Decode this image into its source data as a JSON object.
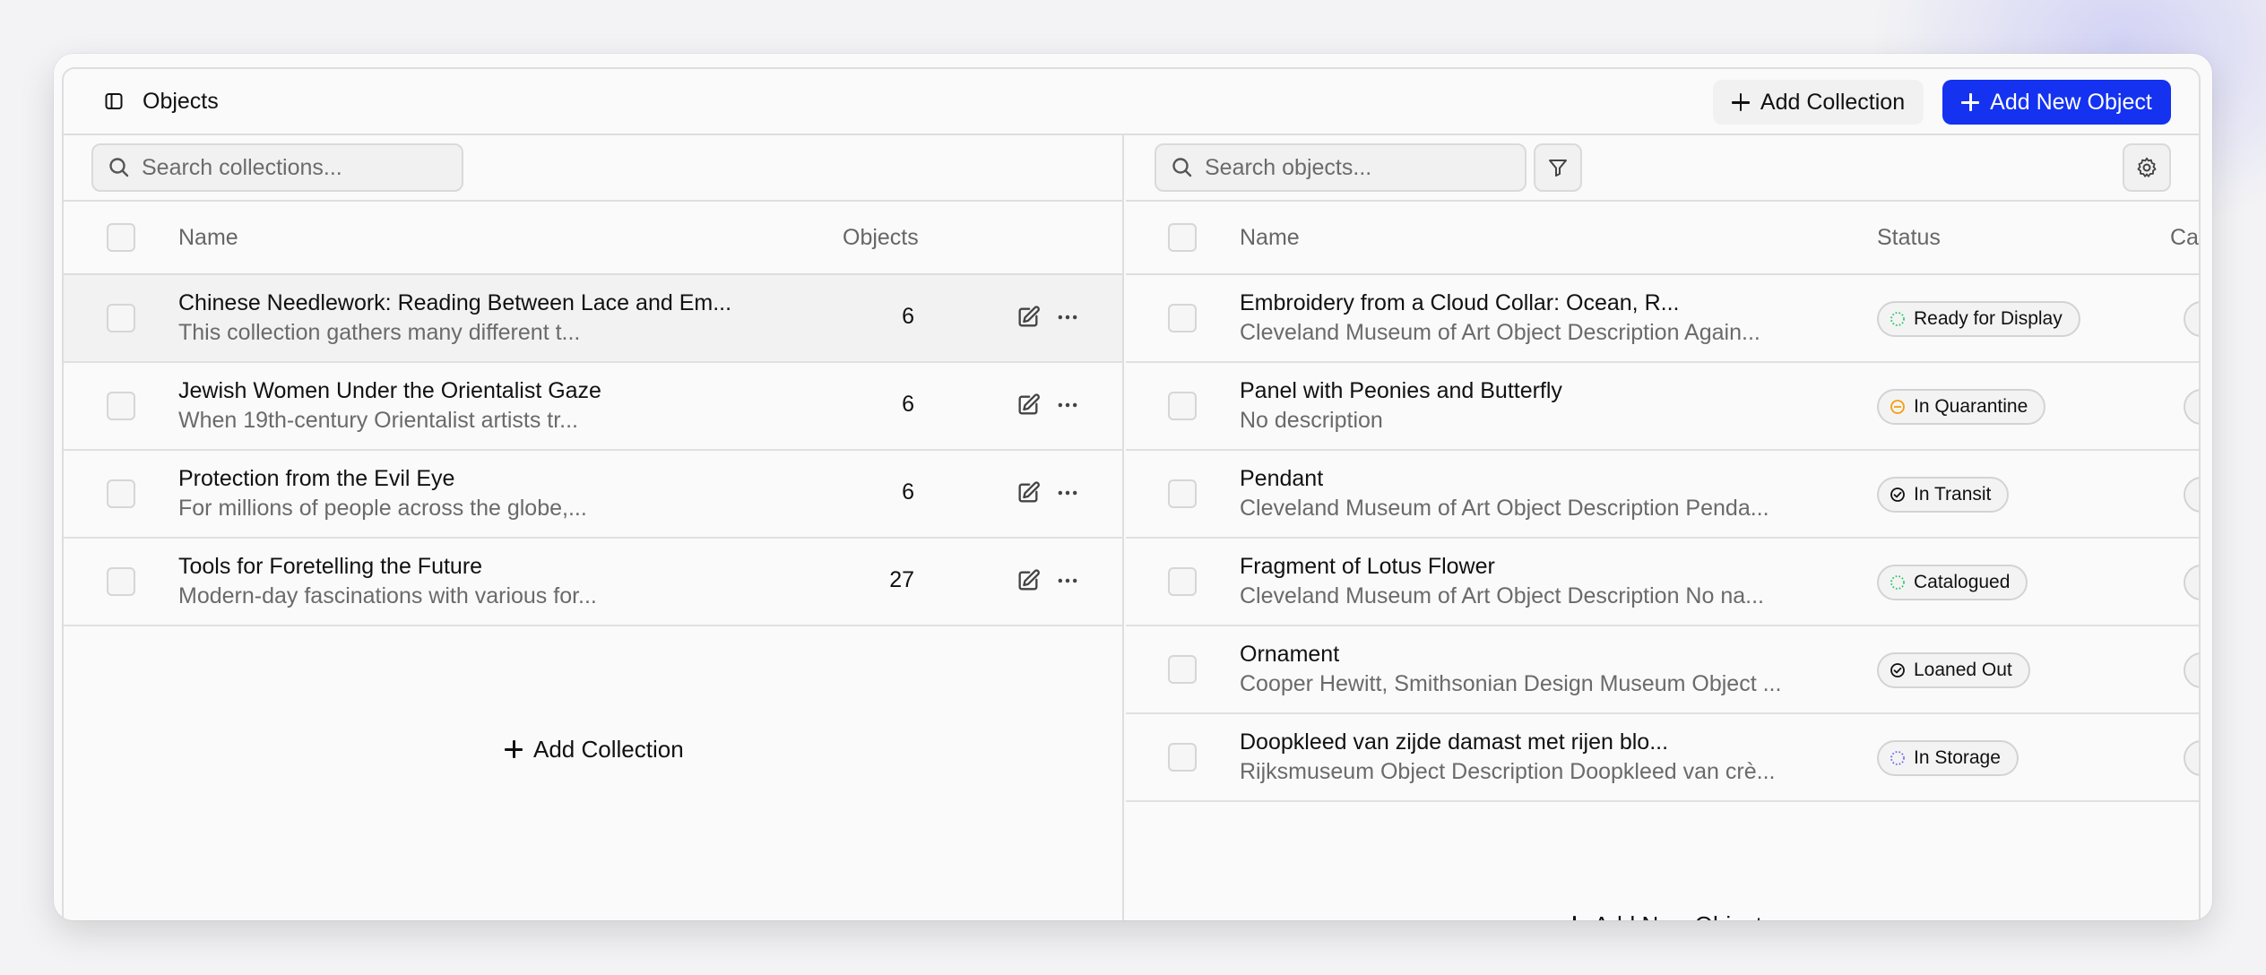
{
  "header": {
    "title": "Objects",
    "add_collection_label": "Add Collection",
    "add_object_label": "Add New Object",
    "accent_color": "#1432f0"
  },
  "collections": {
    "search_placeholder": "Search collections...",
    "columns": {
      "name": "Name",
      "objects": "Objects"
    },
    "rows": [
      {
        "title": "Chinese Needlework: Reading Between Lace and Em...",
        "desc": "This collection gathers many different t...",
        "count": "6"
      },
      {
        "title": "Jewish Women Under the Orientalist Gaze",
        "desc": "When 19th-century Orientalist artists tr...",
        "count": "6"
      },
      {
        "title": "Protection from the Evil Eye",
        "desc": "For millions of people across the globe,...",
        "count": "6"
      },
      {
        "title": "Tools for Foretelling the Future",
        "desc": "Modern-day fascinations with various for...",
        "count": "27"
      }
    ],
    "add_label": "Add Collection"
  },
  "objects": {
    "search_placeholder": "Search objects...",
    "columns": {
      "name": "Name",
      "status": "Status",
      "category": "Cat"
    },
    "rows": [
      {
        "title": "Embroidery from a Cloud Collar: Ocean, R...",
        "desc": "Cleveland Museum of Art Object Description Again...",
        "status": "Ready for Display",
        "status_icon": "dotted-circle-icon",
        "status_color": "#22c55e",
        "cat_color": "#ef4455"
      },
      {
        "title": "Panel with Peonies and Butterfly",
        "desc": "No description",
        "status": "In Quarantine",
        "status_icon": "minus-circle-icon",
        "status_color": "#f59e0b",
        "cat_color": "#8b5cf6"
      },
      {
        "title": "Pendant",
        "desc": "Cleveland Museum of Art Object Description Penda...",
        "status": "In Transit",
        "status_icon": "check-circle-icon",
        "status_color": "#111111",
        "cat_color": "#f59e0b"
      },
      {
        "title": "Fragment of Lotus Flower",
        "desc": "Cleveland Museum of Art Object Description No na...",
        "status": "Catalogued",
        "status_icon": "dotted-circle-icon",
        "status_color": "#22c55e",
        "cat_color": ""
      },
      {
        "title": "Ornament",
        "desc": "Cooper Hewitt, Smithsonian Design Museum Object ...",
        "status": "Loaned Out",
        "status_icon": "check-circle-icon",
        "status_color": "#111111",
        "cat_color": "#8b5cf6"
      },
      {
        "title": "Doopkleed van zijde damast met rijen blo...",
        "desc": "Rijksmuseum Object Description Doopkleed van crè...",
        "status": "In Storage",
        "status_icon": "dotted-circle-icon",
        "status_color": "#6366f1",
        "cat_color": "#8b5cf6"
      }
    ],
    "add_label": "Add New Object"
  }
}
